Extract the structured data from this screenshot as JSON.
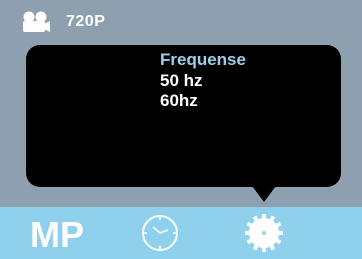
{
  "header": {
    "resolution": "720P",
    "icon": "camera-icon"
  },
  "menu": {
    "title": "Frequense",
    "options": [
      "50 hz",
      "60hz"
    ]
  },
  "bottom_bar": {
    "mode_label": "MP",
    "icons": [
      "clock-icon",
      "gear-icon"
    ]
  },
  "colors": {
    "background": "#8e9fb0",
    "menu_bg": "#000000",
    "menu_title": "#9ad0ee",
    "bottom_bar": "#8fd0ec",
    "text": "#ffffff"
  }
}
